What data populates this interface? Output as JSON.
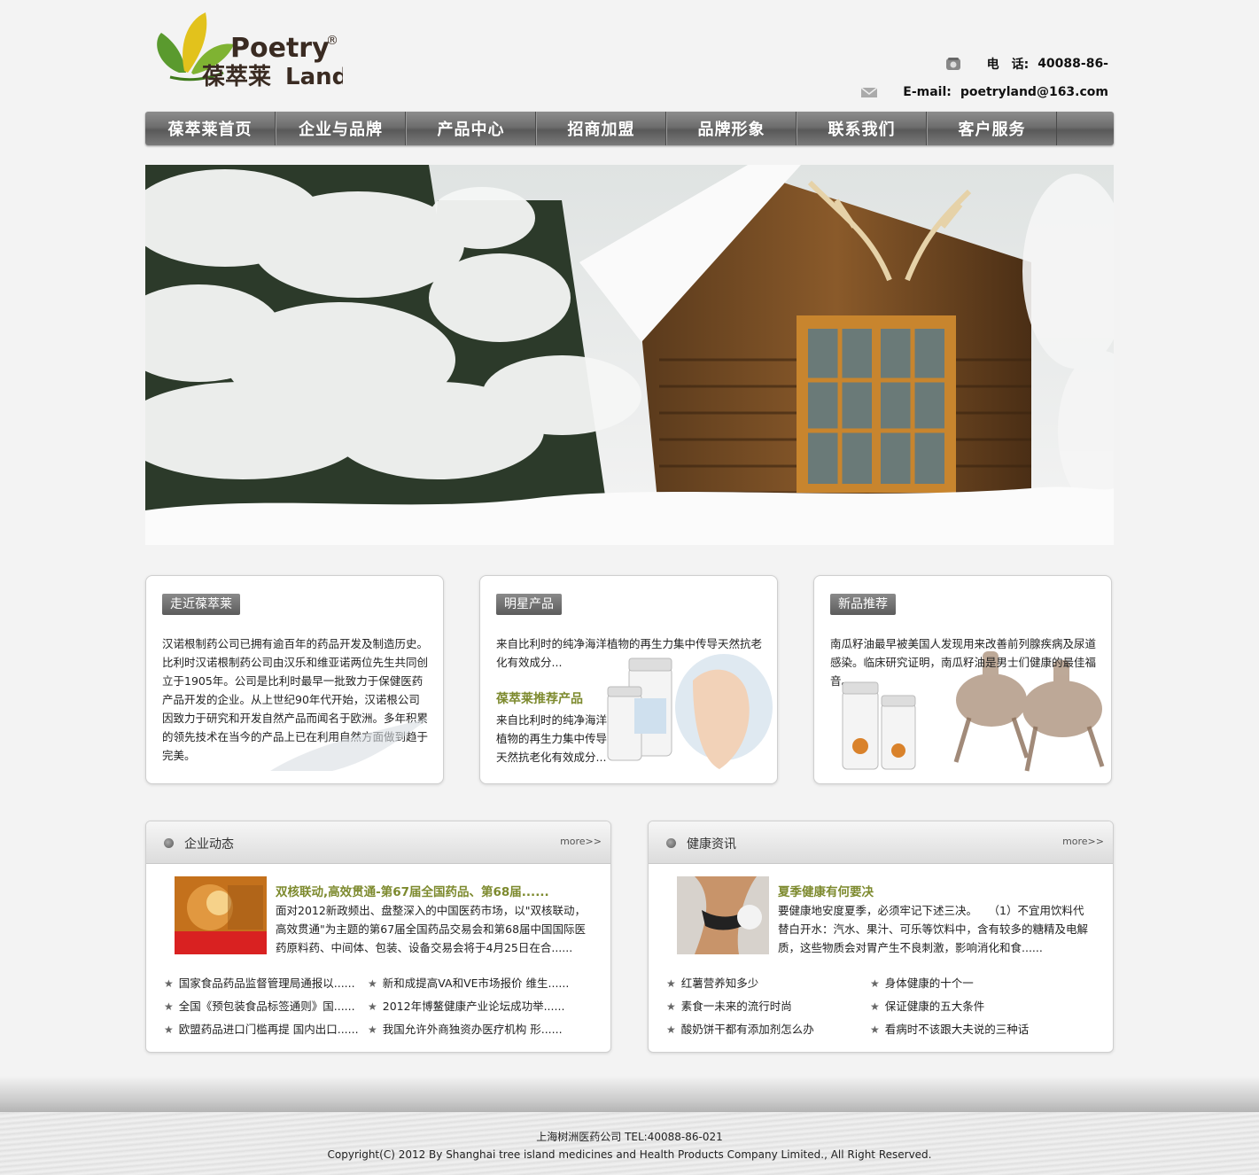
{
  "logo": {
    "en_text": "Poetry",
    "en_text2": "Land",
    "cn_text": "葆萃莱",
    "registered": "®"
  },
  "contact": {
    "phone_label": "电　话:",
    "phone_value": "40088-86-",
    "email_label": "E-mail:",
    "email_value": "poetryland@163.com"
  },
  "nav": {
    "items": [
      "葆萃莱首页",
      "企业与品牌",
      "产品中心",
      "招商加盟",
      "品牌形象",
      "联系我们",
      "客户服务"
    ]
  },
  "boxes": [
    {
      "tag": "走近葆萃莱",
      "text": "汉诺根制药公司已拥有逾百年的药品开发及制造历史。比利时汉诺根制药公司由汉乐和维亚诺两位先生共同创立于1905年。公司是比利时最早一批致力于保健医药产品开发的企业。从上世纪90年代开始，汉诺根公司因致力于研究和开发自然产品而闻名于欧洲。多年积累的领先技术在当今的产品上已在利用自然方面做到趋于完美。"
    },
    {
      "tag": "明星产品",
      "text": "来自比利时的纯净海洋植物的再生力集中传导天然抗老化有效成分...",
      "sub_title": "葆萃莱推荐产品",
      "sub_text": "来自比利时的纯净海洋植物的再生力集中传导天然抗老化有效成分..."
    },
    {
      "tag": "新品推荐",
      "text": "南瓜籽油最早被美国人发现用来改善前列腺疾病及尿道感染。临床研究证明，南瓜籽油是男士们健康的最佳福音。"
    }
  ],
  "panels": [
    {
      "title": "企业动态",
      "more": "more>>",
      "feature_title": "双核联动,高效贯通-第67届全国药品、第68届......",
      "feature_text": "面对2012新政频出、盘整深入的中国医药市场，以\"双核联动，高效贯通\"为主题的第67届全国药品交易会和第68届中国国际医药原料药、中间体、包装、设备交易会将于4月25日在合......",
      "links": [
        "国家食品药品监督管理局通报以......",
        "新和成提高VA和VE市场报价 维生......",
        "全国《预包装食品标签通则》国......",
        "2012年博鳌健康产业论坛成功举......",
        "欧盟药品进口门槛再提 国内出口......",
        "我国允许外商独资办医疗机构 形......"
      ]
    },
    {
      "title": "健康资讯",
      "more": "more>>",
      "feature_title": "夏季健康有何要决",
      "feature_text": "要健康地安度夏季，必须牢记下述三决。　　（1）不宜用饮料代替白开水：汽水、果汁、可乐等饮料中，含有较多的糖精及电解质，这些物质会对胃产生不良刺激，影响消化和食......",
      "links": [
        "红薯营养知多少",
        "身体健康的十个一",
        "素食一未来的流行时尚",
        "保证健康的五大条件",
        "酸奶饼干都有添加剂怎么办",
        "看病时不该跟大夫说的三种话"
      ]
    }
  ],
  "footer": {
    "line1": "上海树洲医药公司 TEL:40088-86-021",
    "line2": "Copyright(C) 2012 By Shanghai tree island medicines and Health Products Company Limited., All Right Reserved."
  }
}
